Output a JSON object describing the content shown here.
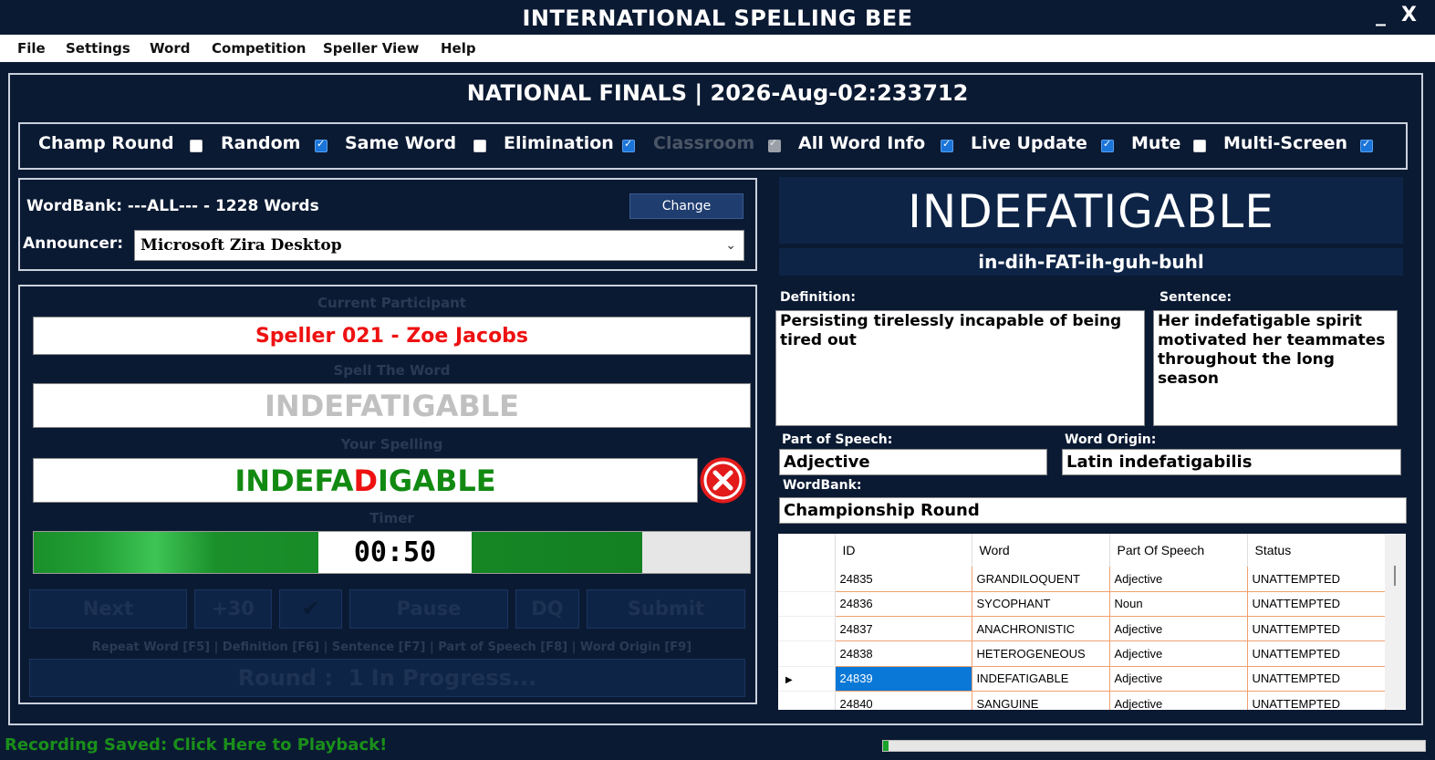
{
  "window": {
    "title": "INTERNATIONAL SPELLING BEE",
    "minimize": "_",
    "close": "X"
  },
  "menu": [
    "File",
    "Settings",
    "Word",
    "Competition",
    "Speller View",
    "Help"
  ],
  "page_title": "NATIONAL FINALS | 2026-Aug-02:233712",
  "options": [
    {
      "label": "Champ Round",
      "checked": false,
      "enabled": true
    },
    {
      "label": "Random",
      "checked": true,
      "enabled": true
    },
    {
      "label": "Same Word",
      "checked": false,
      "enabled": true
    },
    {
      "label": "Elimination",
      "checked": true,
      "enabled": true
    },
    {
      "label": "Classroom",
      "checked": true,
      "enabled": false
    },
    {
      "label": "All Word Info",
      "checked": true,
      "enabled": true
    },
    {
      "label": "Live Update",
      "checked": true,
      "enabled": true
    },
    {
      "label": "Mute",
      "checked": false,
      "enabled": true
    },
    {
      "label": "Multi-Screen",
      "checked": true,
      "enabled": true
    }
  ],
  "wordbank_panel": {
    "label": "WordBank: ---ALL--- - 1228 Words",
    "change_button": "Change",
    "announcer_label": "Announcer:",
    "announcer_value": "Microsoft Zira Desktop"
  },
  "participant": {
    "current_label": "Current Participant",
    "speller": "Speller 021 - Zoe Jacobs",
    "spell_label": "Spell The Word",
    "word": "INDEFATIGABLE",
    "your_spelling_label": "Your Spelling",
    "your_spelling_correct_1": "INDEFA",
    "your_spelling_wrong": "D",
    "your_spelling_correct_2": "IGABLE",
    "result_icon": "wrong-x-icon",
    "timer_label": "Timer",
    "timer_text": "00:50",
    "timer_fill_fraction": 0.85
  },
  "controls": {
    "next": "Next",
    "plus30": "+30",
    "check_icon": "checkmark-icon",
    "pause": "Pause",
    "dq": "DQ",
    "submit": "Submit"
  },
  "hotkeys": "Repeat Word [F5] | Definition [F6] | Sentence [F7] | Part of Speech [F8] | Word Origin [F9]",
  "round_status": "Round :  1 In Progress...",
  "word_info": {
    "word": "INDEFATIGABLE",
    "pronunciation": "in-dih-FAT-ih-guh-buhl",
    "definition_label": "Definition:",
    "definition": "Persisting tirelessly incapable of being tired out",
    "sentence_label": "Sentence:",
    "sentence": "Her indefatigable spirit motivated her teammates throughout the long season",
    "pos_label": "Part of Speech:",
    "pos": "Adjective",
    "origin_label": "Word Origin:",
    "origin": "Latin indefatigabilis",
    "wordbank_label": "WordBank:",
    "wordbank": "Championship Round"
  },
  "grid": {
    "columns": [
      "ID",
      "Word",
      "Part Of Speech",
      "Status"
    ],
    "rows": [
      {
        "id": "24835",
        "word": "GRANDILOQUENT",
        "pos": "Adjective",
        "status": "UNATTEMPTED",
        "selected": false
      },
      {
        "id": "24836",
        "word": "SYCOPHANT",
        "pos": "Noun",
        "status": "UNATTEMPTED",
        "selected": false
      },
      {
        "id": "24837",
        "word": "ANACHRONISTIC",
        "pos": "Adjective",
        "status": "UNATTEMPTED",
        "selected": false
      },
      {
        "id": "24838",
        "word": "HETEROGENEOUS",
        "pos": "Adjective",
        "status": "UNATTEMPTED",
        "selected": false
      },
      {
        "id": "24839",
        "word": "INDEFATIGABLE",
        "pos": "Adjective",
        "status": "UNATTEMPTED",
        "selected": true
      },
      {
        "id": "24840",
        "word": "SANGUINE",
        "pos": "Adjective",
        "status": "UNATTEMPTED",
        "selected": false
      }
    ]
  },
  "status_bar": {
    "recording": "Recording Saved: Click Here to Playback!",
    "progress_fraction": 0.01
  },
  "colors": {
    "background": "#0b1a33",
    "panel": "#0e2447",
    "speller_red": "#ee1111",
    "correct_green": "#128a12",
    "checkbox_blue": "#1b74d8",
    "selection_blue": "#0a78d7",
    "grid_border": "#f0a070"
  }
}
